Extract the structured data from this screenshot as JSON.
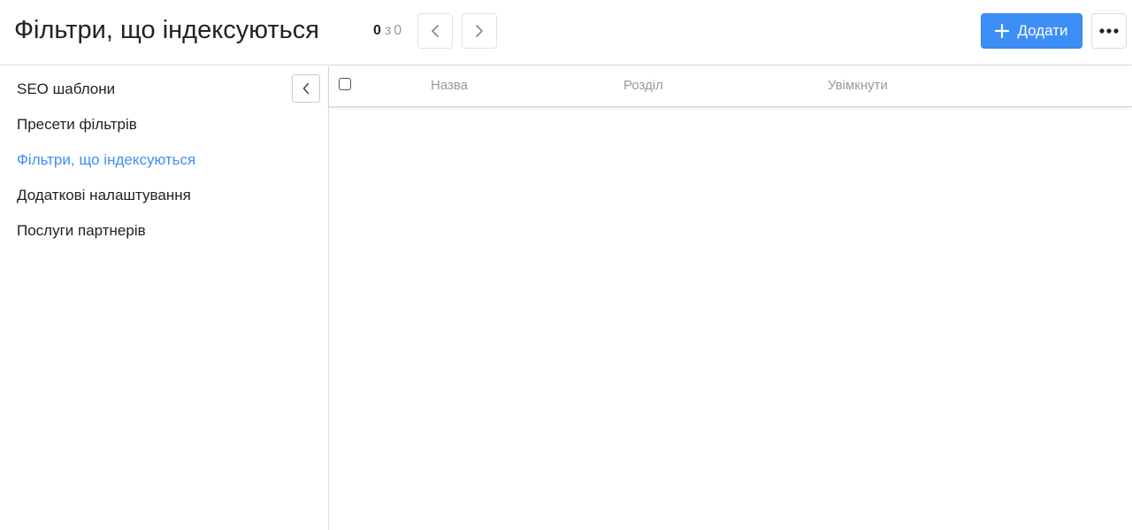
{
  "header": {
    "title": "Фільтри, що індексуються",
    "counter": {
      "current": "0",
      "separator": "з",
      "total": "0"
    },
    "add_label": "Додати"
  },
  "sidebar": {
    "items": [
      {
        "label": "SEO шаблони",
        "active": false
      },
      {
        "label": "Пресети фільтрів",
        "active": false
      },
      {
        "label": "Фільтри, що індексуються",
        "active": true
      },
      {
        "label": "Додаткові налаштування",
        "active": false
      },
      {
        "label": "Послуги партнерів",
        "active": false
      }
    ]
  },
  "table": {
    "columns": [
      "Назва",
      "Розділ",
      "Увімкнути"
    ],
    "rows": []
  },
  "icons": {
    "prev": "chevron-left-icon",
    "next": "chevron-right-icon",
    "add": "plus-icon",
    "more": "more-horizontal-icon",
    "collapse": "chevron-left-icon"
  },
  "colors": {
    "accent": "#3e8ef7",
    "text": "#222222",
    "muted": "#999999",
    "border": "#dcdcdc"
  }
}
